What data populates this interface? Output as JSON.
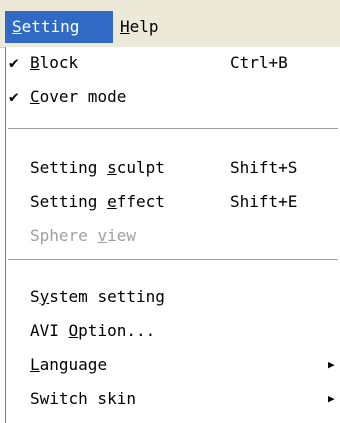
{
  "menubar": {
    "setting": {
      "label": "Setting",
      "accel": "S",
      "rest": "etting"
    },
    "help": {
      "label": "Help",
      "accel": "H",
      "rest": "elp"
    }
  },
  "menu": {
    "block": {
      "checked": true,
      "check_glyph": "✔",
      "pre": "",
      "accel": "B",
      "post": "lock",
      "shortcut": "Ctrl+B"
    },
    "cover_mode": {
      "checked": true,
      "check_glyph": "✔",
      "pre": "",
      "accel": "C",
      "post": "over mode"
    },
    "setting_sculpt": {
      "pre": "Setting ",
      "accel": "s",
      "post": "culpt",
      "shortcut": "Shift+S"
    },
    "setting_effect": {
      "pre": "Setting ",
      "accel": "e",
      "post": "ffect",
      "shortcut": "Shift+E"
    },
    "sphere_view": {
      "pre": "Sphere ",
      "accel": "v",
      "post": "iew",
      "disabled": true
    },
    "system_setting": {
      "pre": "S",
      "accel": "y",
      "post": "stem setting"
    },
    "avi_option": {
      "pre": "AVI ",
      "accel": "O",
      "post": "ption..."
    },
    "language": {
      "pre": "",
      "accel": "L",
      "post": "anguage",
      "submenu_glyph": "▶"
    },
    "switch_skin": {
      "pre": "Switch skin",
      "accel": "",
      "post": "",
      "submenu_glyph": "▶"
    }
  }
}
